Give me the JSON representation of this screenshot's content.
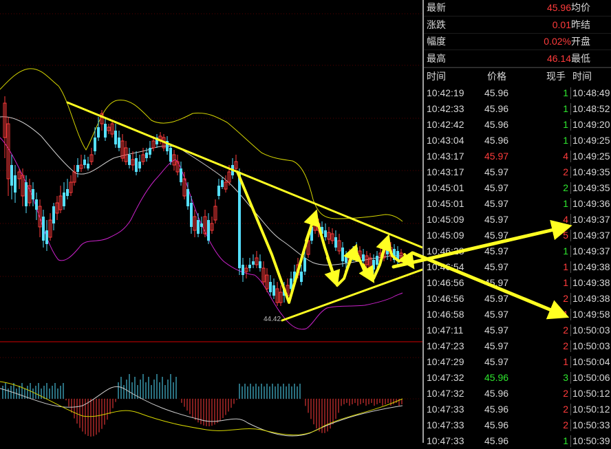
{
  "quote": {
    "rows": [
      {
        "label": "最新",
        "value": "45.96",
        "label2": "均价"
      },
      {
        "label": "涨跌",
        "value": "0.01",
        "label2": "昨结"
      },
      {
        "label": "幅度",
        "value": "0.02%",
        "label2": "开盘"
      },
      {
        "label": "最高",
        "value": "46.14",
        "label2": "最低"
      }
    ]
  },
  "ticks": {
    "headers": {
      "time": "时间",
      "price": "价格",
      "volume": "现手",
      "time2": "时间"
    },
    "rows": [
      {
        "time": "10:42:19",
        "price": "45.96",
        "vol": "1",
        "vol_color": "green",
        "price_color": "white",
        "time2": "10:48:49"
      },
      {
        "time": "10:42:33",
        "price": "45.96",
        "vol": "1",
        "vol_color": "green",
        "price_color": "white",
        "time2": "10:48:52"
      },
      {
        "time": "10:42:42",
        "price": "45.96",
        "vol": "1",
        "vol_color": "green",
        "price_color": "white",
        "time2": "10:49:20"
      },
      {
        "time": "10:43:04",
        "price": "45.96",
        "vol": "1",
        "vol_color": "green",
        "price_color": "white",
        "time2": "10:49:25"
      },
      {
        "time": "10:43:17",
        "price": "45.97",
        "vol": "4",
        "vol_color": "red",
        "price_color": "red",
        "time2": "10:49:25"
      },
      {
        "time": "10:43:17",
        "price": "45.97",
        "vol": "2",
        "vol_color": "red",
        "price_color": "white",
        "time2": "10:49:35"
      },
      {
        "time": "10:45:01",
        "price": "45.97",
        "vol": "2",
        "vol_color": "green",
        "price_color": "white",
        "time2": "10:49:35"
      },
      {
        "time": "10:45:01",
        "price": "45.97",
        "vol": "1",
        "vol_color": "green",
        "price_color": "white",
        "time2": "10:49:36"
      },
      {
        "time": "10:45:09",
        "price": "45.97",
        "vol": "4",
        "vol_color": "red",
        "price_color": "white",
        "time2": "10:49:37"
      },
      {
        "time": "10:45:09",
        "price": "45.97",
        "vol": "5",
        "vol_color": "red",
        "price_color": "white",
        "time2": "10:49:37"
      },
      {
        "time": "10:46:28",
        "price": "45.97",
        "vol": "1",
        "vol_color": "green",
        "price_color": "white",
        "time2": "10:49:37"
      },
      {
        "time": "10:46:54",
        "price": "45.97",
        "vol": "1",
        "vol_color": "red",
        "price_color": "white",
        "time2": "10:49:38"
      },
      {
        "time": "10:46:56",
        "price": "45.97",
        "vol": "1",
        "vol_color": "red",
        "price_color": "white",
        "time2": "10:49:38"
      },
      {
        "time": "10:46:56",
        "price": "45.97",
        "vol": "2",
        "vol_color": "red",
        "price_color": "white",
        "time2": "10:49:38"
      },
      {
        "time": "10:46:58",
        "price": "45.97",
        "vol": "1",
        "vol_color": "red",
        "price_color": "white",
        "time2": "10:49:58"
      },
      {
        "time": "10:47:11",
        "price": "45.97",
        "vol": "2",
        "vol_color": "red",
        "price_color": "white",
        "time2": "10:50:03"
      },
      {
        "time": "10:47:23",
        "price": "45.97",
        "vol": "2",
        "vol_color": "red",
        "price_color": "white",
        "time2": "10:50:03"
      },
      {
        "time": "10:47:29",
        "price": "45.97",
        "vol": "1",
        "vol_color": "red",
        "price_color": "white",
        "time2": "10:50:04"
      },
      {
        "time": "10:47:32",
        "price": "45.96",
        "vol": "3",
        "vol_color": "green",
        "price_color": "green",
        "time2": "10:50:06"
      },
      {
        "time": "10:47:32",
        "price": "45.96",
        "vol": "2",
        "vol_color": "red",
        "price_color": "white",
        "time2": "10:50:12"
      },
      {
        "time": "10:47:33",
        "price": "45.96",
        "vol": "2",
        "vol_color": "red",
        "price_color": "white",
        "time2": "10:50:12"
      },
      {
        "time": "10:47:33",
        "price": "45.96",
        "vol": "2",
        "vol_color": "red",
        "price_color": "white",
        "time2": "10:50:33"
      },
      {
        "time": "10:47:33",
        "price": "45.96",
        "vol": "1",
        "vol_color": "green",
        "price_color": "white",
        "time2": "10:50:39"
      }
    ]
  },
  "colors": {
    "up": "#ff3b3b",
    "down": "#55e0ff",
    "volume_green": "#2ee62e",
    "volume_red": "#ff3b3b",
    "pattern": "#ffff22",
    "boll_band": "#d6d600",
    "boll_lower": "#cc22cc",
    "boll_mid": "#cfcfcf",
    "grid": "#5a0000"
  },
  "chart_data": {
    "type": "candlestick",
    "indicators": [
      "Bollinger Bands",
      "MACD"
    ],
    "annotations": [
      {
        "type": "label",
        "text": "44.42"
      },
      {
        "type": "trendline",
        "description": "descending resistance line"
      },
      {
        "type": "trendline",
        "description": "ascending support line"
      },
      {
        "type": "zigzag-arrows",
        "description": "price swings inside triangle"
      },
      {
        "type": "arrow",
        "description": "breakout upward"
      },
      {
        "type": "arrow",
        "description": "breakdown downward"
      }
    ],
    "low_label": "44.42"
  }
}
